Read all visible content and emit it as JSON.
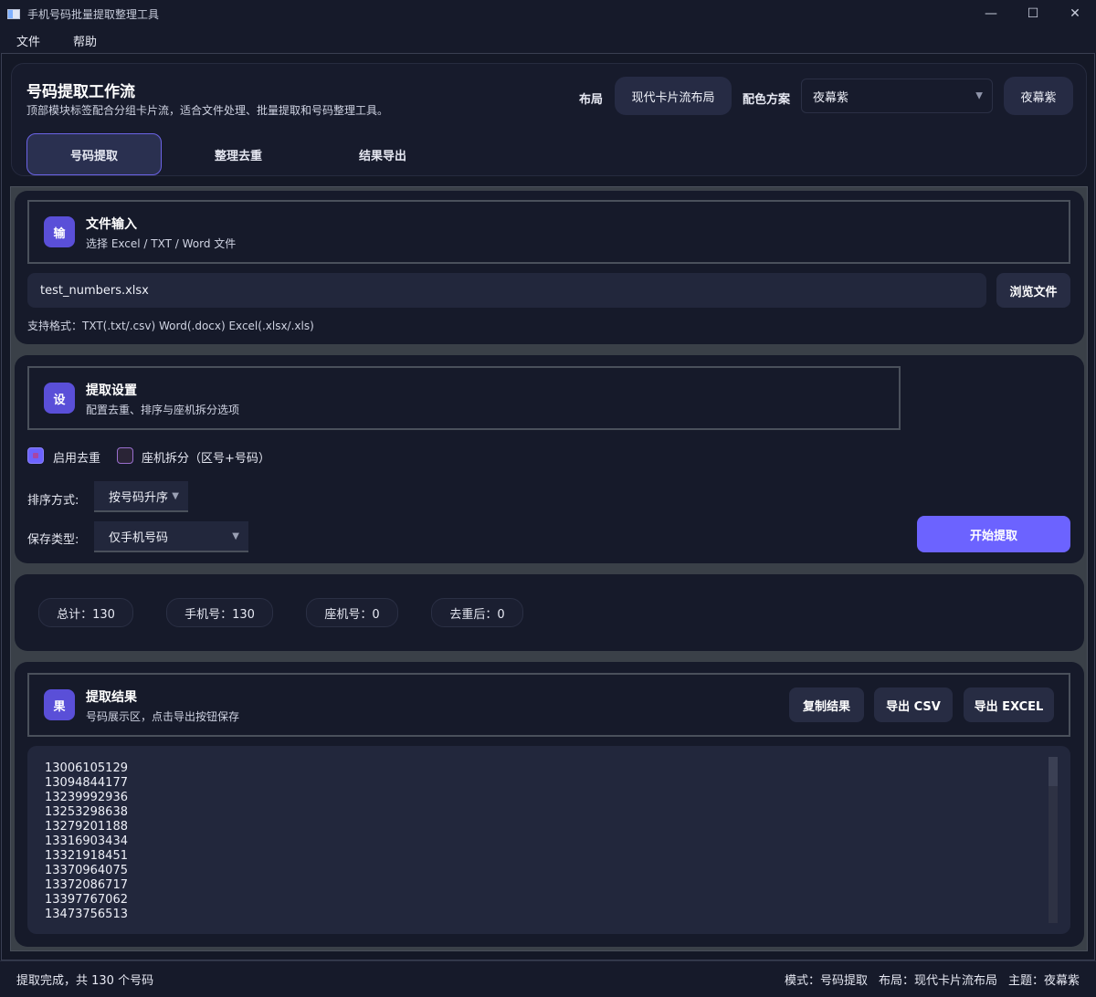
{
  "window": {
    "title": "手机号码批量提取整理工具",
    "controls": {
      "minimize": "—",
      "maximize": "☐",
      "close": "✕"
    }
  },
  "menu": {
    "items": [
      "文件",
      "帮助"
    ]
  },
  "header": {
    "title": "号码提取工作流",
    "subtitle": "顶部模块标签配合分组卡片流，适合文件处理、批量提取和号码整理工具。",
    "layout_label": "布局",
    "layout_value": "现代卡片流布局",
    "scheme_label": "配色方案",
    "scheme_value": "夜幕紫",
    "theme_button": "夜幕紫",
    "tabs": [
      "号码提取",
      "整理去重",
      "结果导出"
    ],
    "active_tab": 0
  },
  "file_input": {
    "badge": "输",
    "title": "文件输入",
    "subtitle": "选择 Excel / TXT / Word 文件",
    "file_value": "test_numbers.xlsx",
    "browse_button": "浏览文件",
    "formats_hint": "支持格式：TXT(.txt/.csv)  Word(.docx)  Excel(.xlsx/.xls)"
  },
  "settings": {
    "badge": "设",
    "title": "提取设置",
    "subtitle": "配置去重、排序与座机拆分选项",
    "dedupe_label": "启用去重",
    "dedupe_checked": true,
    "landline_label": "座机拆分（区号+号码）",
    "landline_checked": false,
    "sort_label": "排序方式:",
    "sort_value": "按号码升序",
    "save_label": "保存类型:",
    "save_value": "仅手机号码",
    "start_button": "开始提取"
  },
  "stats": {
    "total": "总计：130",
    "mobile": "手机号：130",
    "landline": "座机号：0",
    "deduped": "去重后：0"
  },
  "results": {
    "badge": "果",
    "title": "提取结果",
    "subtitle": "号码展示区，点击导出按钮保存",
    "copy_button": "复制结果",
    "csv_button": "导出 CSV",
    "excel_button": "导出 EXCEL",
    "numbers": [
      "13006105129",
      "13094844177",
      "13239992936",
      "13253298638",
      "13279201188",
      "13316903434",
      "13321918451",
      "13370964075",
      "13372086717",
      "13397767062",
      "13473756513"
    ]
  },
  "status": {
    "message": "提取完成，共 130 个号码",
    "mode": "模式：号码提取",
    "layout": "布局：现代卡片流布局",
    "theme": "主题：夜幕紫"
  }
}
